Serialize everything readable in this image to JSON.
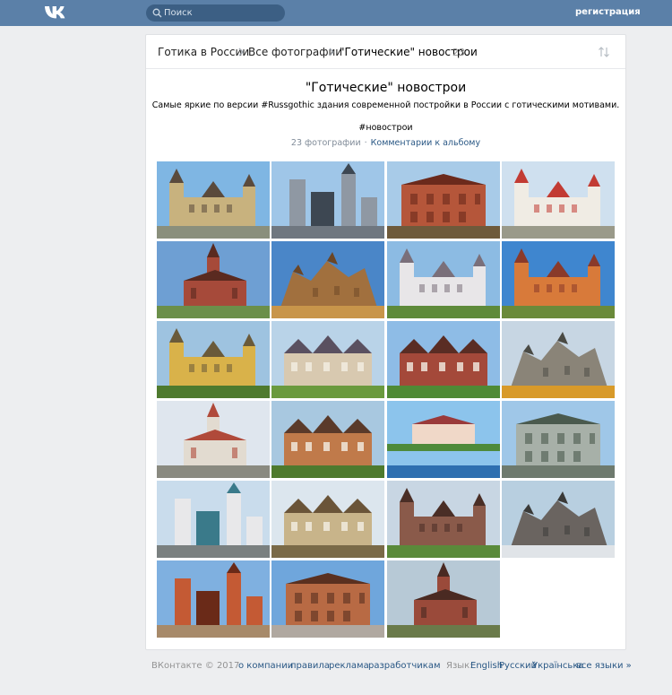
{
  "header": {
    "search_placeholder": "Поиск",
    "register_label": "регистрация"
  },
  "breadcrumb": {
    "items": [
      "Готика в России",
      "Все фотографии",
      "\"Готические\" новострои"
    ],
    "count": "23"
  },
  "album": {
    "title": "\"Готические\" новострои",
    "description": "Самые яркие по версии #Russgothic здания современной постройки в России с готическими мотивами.",
    "tag": "#новострои",
    "photo_count": "23 фотографии",
    "separator": "·",
    "comments_label": "Комментарии к альбому"
  },
  "photos": [
    {
      "sky": "#7fb6e3",
      "ground": "#8a8f7c",
      "building": "#c8b27e",
      "accent": "#5a4a3c",
      "shape": "castle"
    },
    {
      "sky": "#9fc6e8",
      "ground": "#6f7780",
      "building": "#8f98a3",
      "accent": "#3d4752",
      "shape": "towers"
    },
    {
      "sky": "#a8cbe8",
      "ground": "#6e5a3b",
      "building": "#b5563a",
      "accent": "#6b2a1c",
      "shape": "block"
    },
    {
      "sky": "#cfe0ef",
      "ground": "#9a9a8a",
      "building": "#f0ece4",
      "accent": "#c23b33",
      "shape": "castle"
    },
    {
      "sky": "#6e9fd3",
      "ground": "#6b8f4a",
      "building": "#a64a3a",
      "accent": "#5a2a20",
      "shape": "church"
    },
    {
      "sky": "#4a86c8",
      "ground": "#c8954a",
      "building": "#a1703e",
      "accent": "#6b4626",
      "shape": "ruin"
    },
    {
      "sky": "#8cbbe3",
      "ground": "#5e8a3a",
      "building": "#e8e6e8",
      "accent": "#7a6f7a",
      "shape": "castle"
    },
    {
      "sky": "#3f86cf",
      "ground": "#6a8a3a",
      "building": "#d87a3a",
      "accent": "#8a3a2a",
      "shape": "castle"
    },
    {
      "sky": "#9ec3e0",
      "ground": "#4e7a2e",
      "building": "#d9b24a",
      "accent": "#6a5a3a",
      "shape": "castle"
    },
    {
      "sky": "#b9d3e8",
      "ground": "#6a9a3e",
      "building": "#d8c9b0",
      "accent": "#5a5060",
      "shape": "manor"
    },
    {
      "sky": "#8ebce6",
      "ground": "#4f8a35",
      "building": "#a4493a",
      "accent": "#5a2d24",
      "shape": "manor"
    },
    {
      "sky": "#c7d6e3",
      "ground": "#d89a2a",
      "building": "#8a8478",
      "accent": "#4a4a44",
      "shape": "ruin"
    },
    {
      "sky": "#dfe6ee",
      "ground": "#8a8a80",
      "building": "#e2dbd0",
      "accent": "#b04a3a",
      "shape": "church"
    },
    {
      "sky": "#a8c8e0",
      "ground": "#4e7a2e",
      "building": "#c07a4a",
      "accent": "#5a3a2a",
      "shape": "manor"
    },
    {
      "sky": "#8cc4ec",
      "ground": "#2e6fb0",
      "building": "#f0d8c8",
      "accent": "#9a3a3a",
      "shape": "lake"
    },
    {
      "sky": "#9fc7e8",
      "ground": "#6e7a6e",
      "building": "#a7b0a8",
      "accent": "#4a5a4e",
      "shape": "block"
    },
    {
      "sky": "#c9dcec",
      "ground": "#7a8080",
      "building": "#e8e8ea",
      "accent": "#3a7a8a",
      "shape": "towers"
    },
    {
      "sky": "#dce6ee",
      "ground": "#7a6a48",
      "building": "#c8b48a",
      "accent": "#6a5438",
      "shape": "manor"
    },
    {
      "sky": "#c8d6e3",
      "ground": "#5a8a3a",
      "building": "#8a5a4a",
      "accent": "#4a2e26",
      "shape": "castle"
    },
    {
      "sky": "#b8cfe0",
      "ground": "#e0e4e8",
      "building": "#6a6460",
      "accent": "#3a3a38",
      "shape": "ruin"
    },
    {
      "sky": "#7fb0e0",
      "ground": "#a78a6a",
      "building": "#c45a34",
      "accent": "#6a2a18",
      "shape": "towers"
    },
    {
      "sky": "#6fa6dc",
      "ground": "#b0a8a0",
      "building": "#b86a44",
      "accent": "#5a3020",
      "shape": "block"
    },
    {
      "sky": "#b7c9d6",
      "ground": "#6a7a4a",
      "building": "#9a4a3a",
      "accent": "#4a2a22",
      "shape": "church"
    }
  ],
  "footer": {
    "copyright": "ВКонтакте © 2017",
    "links": [
      "о компании",
      "правила",
      "реклама",
      "разработчикам"
    ],
    "language_label": "Язык:",
    "languages": [
      "English",
      "Русский",
      "Українська",
      "все языки »"
    ]
  }
}
